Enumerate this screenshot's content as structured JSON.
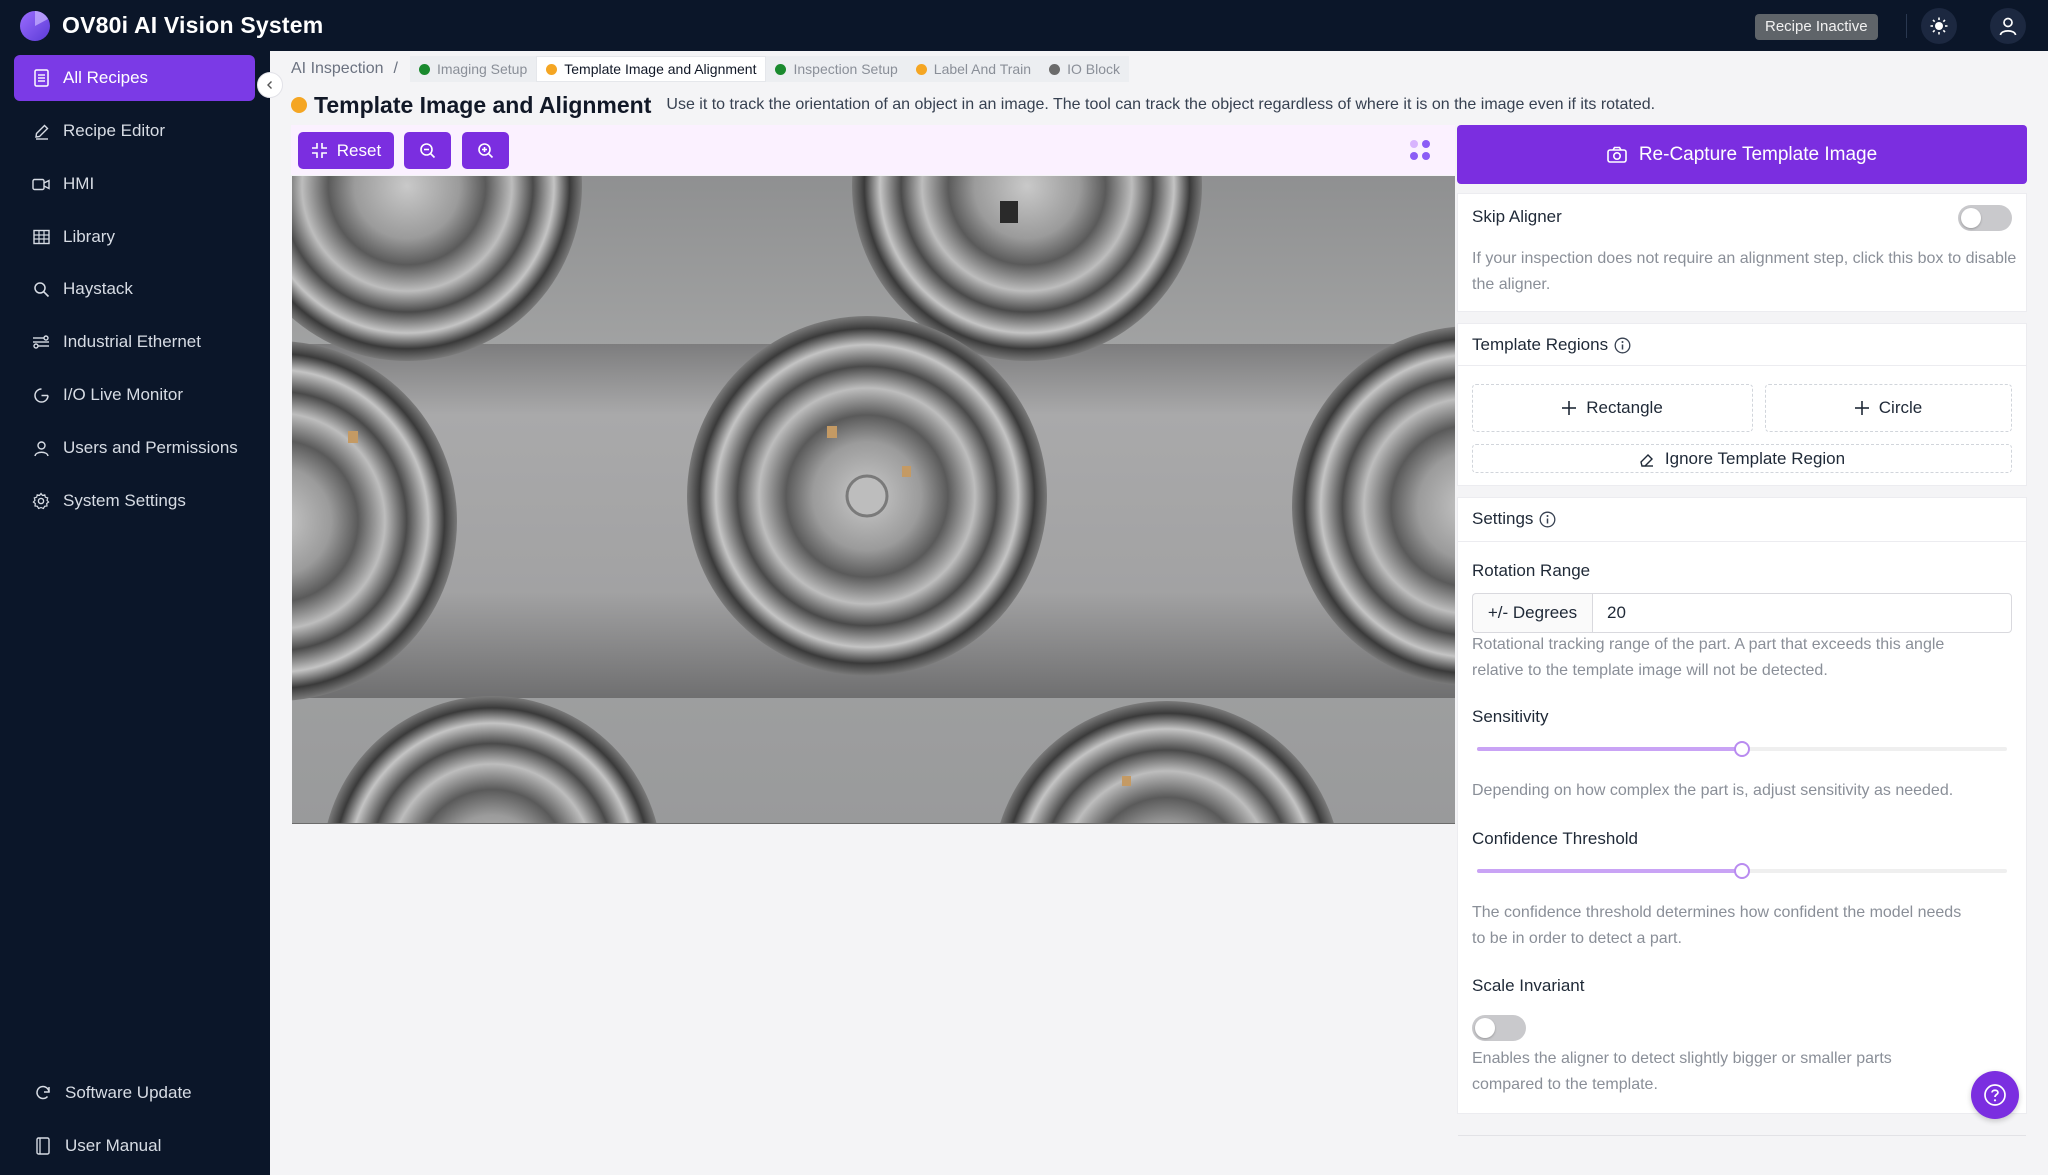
{
  "app": {
    "title": "OV80i AI Vision System",
    "status_badge": "Recipe Inactive"
  },
  "sidebar": {
    "items": [
      {
        "label": "All Recipes",
        "icon": "document-list-icon",
        "active": true
      },
      {
        "label": "Recipe Editor",
        "icon": "pencil-icon"
      },
      {
        "label": "HMI",
        "icon": "video-icon"
      },
      {
        "label": "Library",
        "icon": "grid-table-icon"
      },
      {
        "label": "Haystack",
        "icon": "search-icon"
      },
      {
        "label": "Industrial Ethernet",
        "icon": "network-icon"
      },
      {
        "label": "I/O Live Monitor",
        "icon": "monitor-icon"
      },
      {
        "label": "Users and Permissions",
        "icon": "user-icon"
      },
      {
        "label": "System Settings",
        "icon": "gear-icon"
      }
    ],
    "bottom": [
      {
        "label": "Software Update",
        "icon": "refresh-icon"
      },
      {
        "label": "User Manual",
        "icon": "book-icon"
      }
    ]
  },
  "breadcrumb": {
    "root": "AI Inspection",
    "separator": "/",
    "steps": [
      {
        "label": "Imaging Setup",
        "color": "#1a8a2e"
      },
      {
        "label": "Template Image and Alignment",
        "color": "#f5a623",
        "active": true
      },
      {
        "label": "Inspection Setup",
        "color": "#1a8a2e"
      },
      {
        "label": "Label And Train",
        "color": "#f5a623"
      },
      {
        "label": "IO Block",
        "color": "#6b6b6b"
      }
    ]
  },
  "page": {
    "title": "Template Image and Alignment",
    "description": "Use it to track the orientation of an object in an image. The tool can track the object regardless of where it is on the image even if its rotated."
  },
  "toolbar": {
    "reset_label": "Reset"
  },
  "panel": {
    "recapture_label": "Re-Capture Template Image",
    "skip_aligner": {
      "label": "Skip Aligner",
      "enabled": false,
      "help": "If your inspection does not require an alignment step, click this box to disable the aligner."
    },
    "template_regions": {
      "title": "Template Regions",
      "rectangle_label": "Rectangle",
      "circle_label": "Circle",
      "ignore_label": "Ignore Template Region"
    },
    "settings": {
      "title": "Settings",
      "rotation_range": {
        "label": "Rotation Range",
        "addon": "+/- Degrees",
        "value": "20",
        "help_line1": "Rotational tracking range of the part. A part that exceeds this angle",
        "help_line2": "relative to the template image will not be detected."
      },
      "sensitivity": {
        "label": "Sensitivity",
        "fraction": 0.5,
        "help": "Depending on how complex the part is, adjust sensitivity as needed."
      },
      "confidence": {
        "label": "Confidence Threshold",
        "fraction": 0.5,
        "help_line1": "The confidence threshold determines how confident the model needs",
        "help_line2": "to be in order to detect a part."
      },
      "scale_invariant": {
        "label": "Scale Invariant",
        "enabled": false,
        "help_line1": "Enables the aligner to detect slightly bigger or smaller parts",
        "help_line2": "compared to the template."
      }
    }
  },
  "colors": {
    "accent": "#7b2ee0",
    "sidebar_bg": "#0b1629",
    "active_nav": "#7b3ae6"
  }
}
